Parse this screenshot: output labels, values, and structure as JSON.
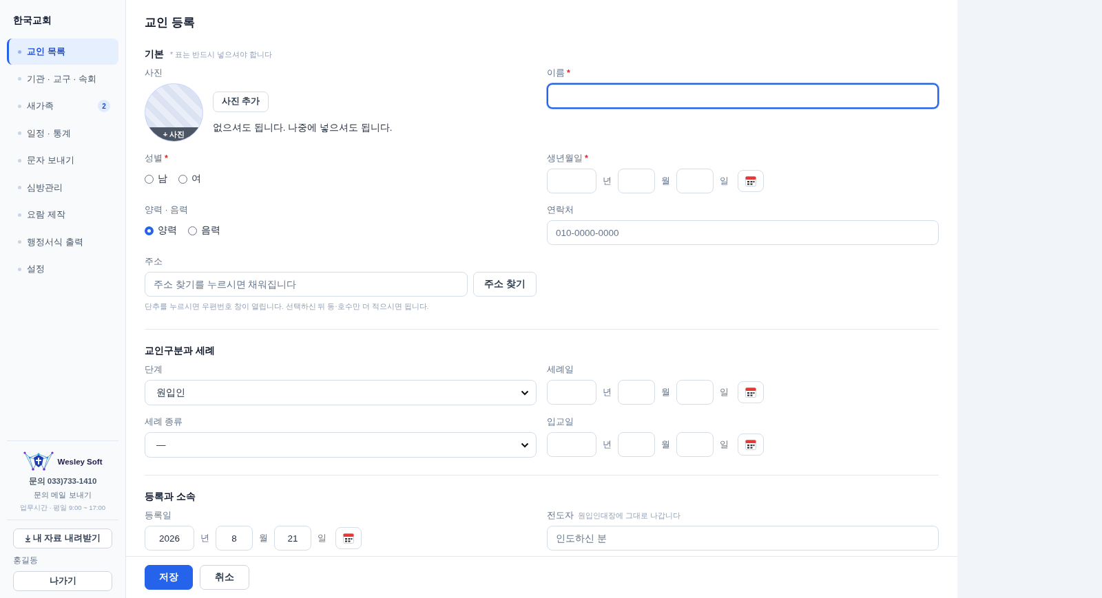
{
  "sidebar": {
    "brand": "한국교회",
    "items": [
      {
        "label": "교인 목록",
        "selected": true
      },
      {
        "label": "기관 · 교구 · 속회",
        "selected": false
      },
      {
        "label": "새가족",
        "selected": false,
        "badge": "2"
      },
      {
        "label": "일정 · 통계",
        "selected": false
      },
      {
        "label": "문자 보내기",
        "selected": false
      },
      {
        "label": "심방관리",
        "selected": false
      },
      {
        "label": "요람 제작",
        "selected": false
      },
      {
        "label": "행정서식 출력",
        "selected": false
      },
      {
        "label": "설정",
        "selected": false
      }
    ],
    "support": {
      "company": "Wesley Soft",
      "phone": "문의 033)733-1410",
      "mail_link": "문의 메일 보내기",
      "hours": "업무시간 · 평일 9:00 ~ 17:00"
    },
    "download_button": "내 자료 내려받기",
    "user": "홍길동",
    "logout_button": "나가기"
  },
  "page": {
    "title": "교인 등록",
    "required_mark": "*"
  },
  "sections": [
    {
      "title": "기본",
      "note": "* 표는 반드시 넣으셔야 합니다",
      "fields": [
        {
          "kind": "photo",
          "label": "사진",
          "overlay": "+ 사진",
          "button": "사진 추가",
          "hint": "없으셔도 됩니다. 나중에 넣으셔도 됩니다."
        },
        {
          "kind": "text",
          "label": "이름",
          "required": true,
          "focused": true
        },
        {
          "kind": "radio",
          "label": "성별",
          "required": true,
          "options": [
            {
              "label": "남",
              "selected": false
            },
            {
              "label": "여",
              "selected": false
            }
          ]
        },
        {
          "kind": "date",
          "label": "생년월일",
          "required": true,
          "parts": [
            {
              "unit": "년"
            },
            {
              "unit": "월"
            },
            {
              "unit": "일"
            }
          ]
        },
        {
          "kind": "radio",
          "label": "양력 · 음력",
          "options": [
            {
              "label": "양력",
              "selected": true
            },
            {
              "label": "음력",
              "selected": false
            }
          ]
        },
        {
          "kind": "text",
          "label": "연락처",
          "placeholder": "010-0000-0000"
        },
        {
          "kind": "address",
          "label": "주소",
          "placeholder": "주소 찾기를 누르시면 채워집니다",
          "button": "주소 찾기",
          "hint": "단추를 누르시면 우편번호 창이 열립니다. 선택하신 뒤 동·호수만 더 적으시면 됩니다."
        }
      ]
    },
    {
      "title": "교인구분과 세례",
      "fields": [
        {
          "kind": "select",
          "label": "단계",
          "value": "원입인"
        },
        {
          "kind": "date",
          "label": "세례일",
          "parts": [
            {
              "unit": "년"
            },
            {
              "unit": "월"
            },
            {
              "unit": "일"
            }
          ]
        },
        {
          "kind": "select",
          "label": "세례 종류",
          "value": "—"
        },
        {
          "kind": "date",
          "label": "입교일",
          "parts": [
            {
              "unit": "년"
            },
            {
              "unit": "월"
            },
            {
              "unit": "일"
            }
          ]
        }
      ]
    },
    {
      "title": "등록과 소속",
      "fields": [
        {
          "kind": "date",
          "label": "등록일",
          "parts": [
            {
              "unit": "년",
              "value": "2026"
            },
            {
              "unit": "월",
              "value": "8"
            },
            {
              "unit": "일",
              "value": "21"
            }
          ]
        },
        {
          "kind": "text",
          "label": "전도자",
          "note": "원입인대장에 그대로 나갑니다",
          "placeholder": "인도하신 분"
        }
      ]
    }
  ],
  "footer": {
    "buttons": [
      {
        "label": "저장",
        "kind": "primary"
      },
      {
        "label": "취소",
        "kind": "secondary"
      }
    ]
  }
}
